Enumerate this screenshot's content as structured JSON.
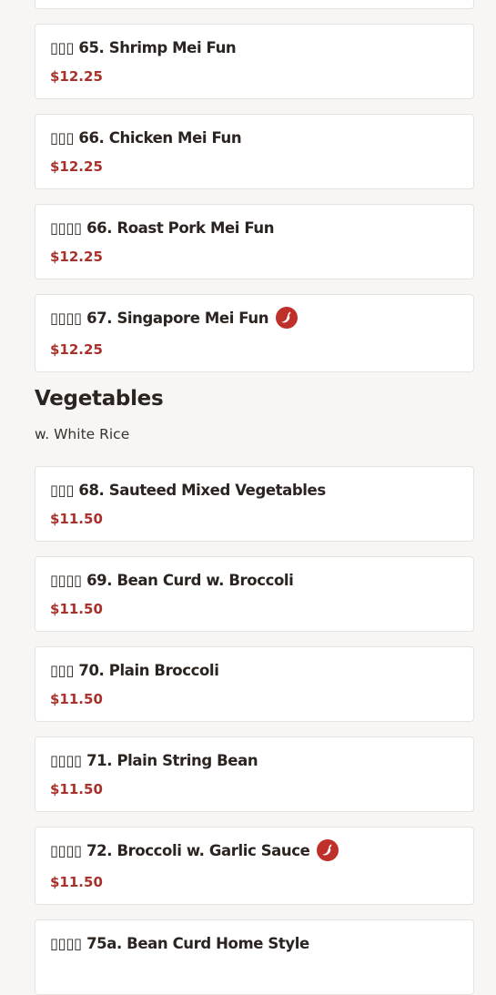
{
  "sections": [
    {
      "items": [
        {
          "name": "",
          "price": ""
        },
        {
          "name": "▯▯▯ 65. Shrimp Mei Fun",
          "price": "$12.25",
          "spicy": false
        },
        {
          "name": "▯▯▯ 66. Chicken Mei Fun",
          "price": "$12.25",
          "spicy": false
        },
        {
          "name": "▯▯▯▯ 66. Roast Pork Mei Fun",
          "price": "$12.25",
          "spicy": false
        },
        {
          "name": "▯▯▯▯ 67. Singapore Mei Fun",
          "price": "$12.25",
          "spicy": true
        }
      ]
    },
    {
      "title": "Vegetables",
      "subtitle": "w. White Rice",
      "items": [
        {
          "name": "▯▯▯ 68. Sauteed Mixed Vegetables",
          "price": "$11.50",
          "spicy": false
        },
        {
          "name": "▯▯▯▯ 69. Bean Curd w. Broccoli",
          "price": "$11.50",
          "spicy": false
        },
        {
          "name": "▯▯▯ 70. Plain Broccoli",
          "price": "$11.50",
          "spicy": false
        },
        {
          "name": "▯▯▯▯ 71. Plain String Bean",
          "price": "$11.50",
          "spicy": false
        },
        {
          "name": "▯▯▯▯ 72. Broccoli w. Garlic Sauce",
          "price": "$11.50",
          "spicy": true
        },
        {
          "name": "▯▯▯▯ 75a. Bean Curd Home Style",
          "price": "",
          "spicy": false
        }
      ]
    }
  ],
  "colors": {
    "accent": "#a8322b",
    "spicy_badge": "#c0302a",
    "background": "#f7f6f4"
  },
  "icons": {
    "spicy": "chili-pepper-icon"
  }
}
